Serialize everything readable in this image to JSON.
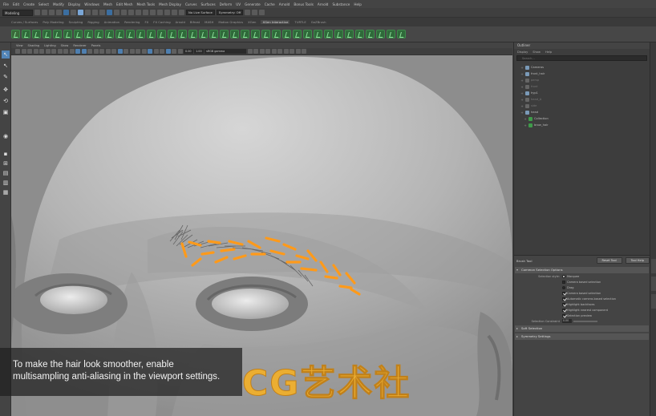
{
  "menubar": {
    "items": [
      "File",
      "Edit",
      "Create",
      "Select",
      "Modify",
      "Display",
      "Windows",
      "Mesh",
      "Edit Mesh",
      "Mesh Tools",
      "Mesh Display",
      "Curves",
      "Surfaces",
      "Deform",
      "UV",
      "Generate",
      "Cache",
      "Arnold",
      "Bonus Tools",
      "Arnold",
      "Substance",
      "Help"
    ]
  },
  "statusline": {
    "mode": "Modeling",
    "no_live_surface": "No Live Surface",
    "symmetry": "Symmetry: Off"
  },
  "shelf_tabs": {
    "items": [
      "Curves / Surfaces",
      "Poly Modeling",
      "Sculpting",
      "Rigging",
      "Animation",
      "Rendering",
      "FX",
      "FX Caching",
      "Arnold",
      "Bifrost",
      "MASH",
      "Motion Graphics",
      "XGen",
      "XGen Interactive",
      "TURTLE",
      "GoZBrush"
    ],
    "active_index": 13
  },
  "viewport": {
    "menu": [
      "View",
      "Shading",
      "Lighting",
      "Show",
      "Renderer",
      "Panels"
    ],
    "toolbar_fields": [
      "0.00",
      "1.00",
      "sRGB gamma"
    ]
  },
  "caption": {
    "line1": "To make the hair look smoother, enable",
    "line2": "multisampling anti-aliasing in the viewport settings."
  },
  "watermark": {
    "text": "CG艺术社"
  },
  "outliner": {
    "title": "Outliner",
    "menu": [
      "Display",
      "Show",
      "Help"
    ],
    "search_placeholder": "Search...",
    "items": [
      {
        "label": "Cameras",
        "style": "normal"
      },
      {
        "label": "front_hair",
        "style": "normal"
      },
      {
        "label": "persp",
        "style": "dim"
      },
      {
        "label": "front",
        "style": "dim"
      },
      {
        "label": "hyp1",
        "style": "normal"
      },
      {
        "label": "head_A",
        "style": "dim"
      },
      {
        "label": "side",
        "style": "dim"
      },
      {
        "label": "head",
        "style": "normal"
      },
      {
        "label": "Collection",
        "style": "green"
      },
      {
        "label": "brow_hair",
        "style": "green"
      }
    ]
  },
  "tool_settings": {
    "title": "Brush Tool",
    "reset_label": "Reset Tool",
    "help_label": "Tool Help",
    "section_common": "Common Selection Options",
    "rows": [
      {
        "label": "Selection style:",
        "text": "Marquee",
        "kind": "radio"
      },
      {
        "label": "",
        "text": "Camera based selection",
        "kind": "check"
      },
      {
        "label": "",
        "text": "Drag",
        "kind": "radio"
      },
      {
        "label": "",
        "text": "Camera based selection",
        "kind": "check"
      },
      {
        "label": "",
        "text": "Automatic camera-based selection",
        "kind": "check"
      },
      {
        "label": "",
        "text": "Highlight backfaces",
        "kind": "check"
      },
      {
        "label": "",
        "text": "Highlight nearest component",
        "kind": "check"
      },
      {
        "label": "",
        "text": "Selection preview",
        "kind": "check"
      }
    ],
    "preselection_label": "Selection Constraint",
    "preselection_value": "0.00",
    "section_soft": "Soft Selection",
    "section_symmetry": "Symmetry Settings"
  }
}
